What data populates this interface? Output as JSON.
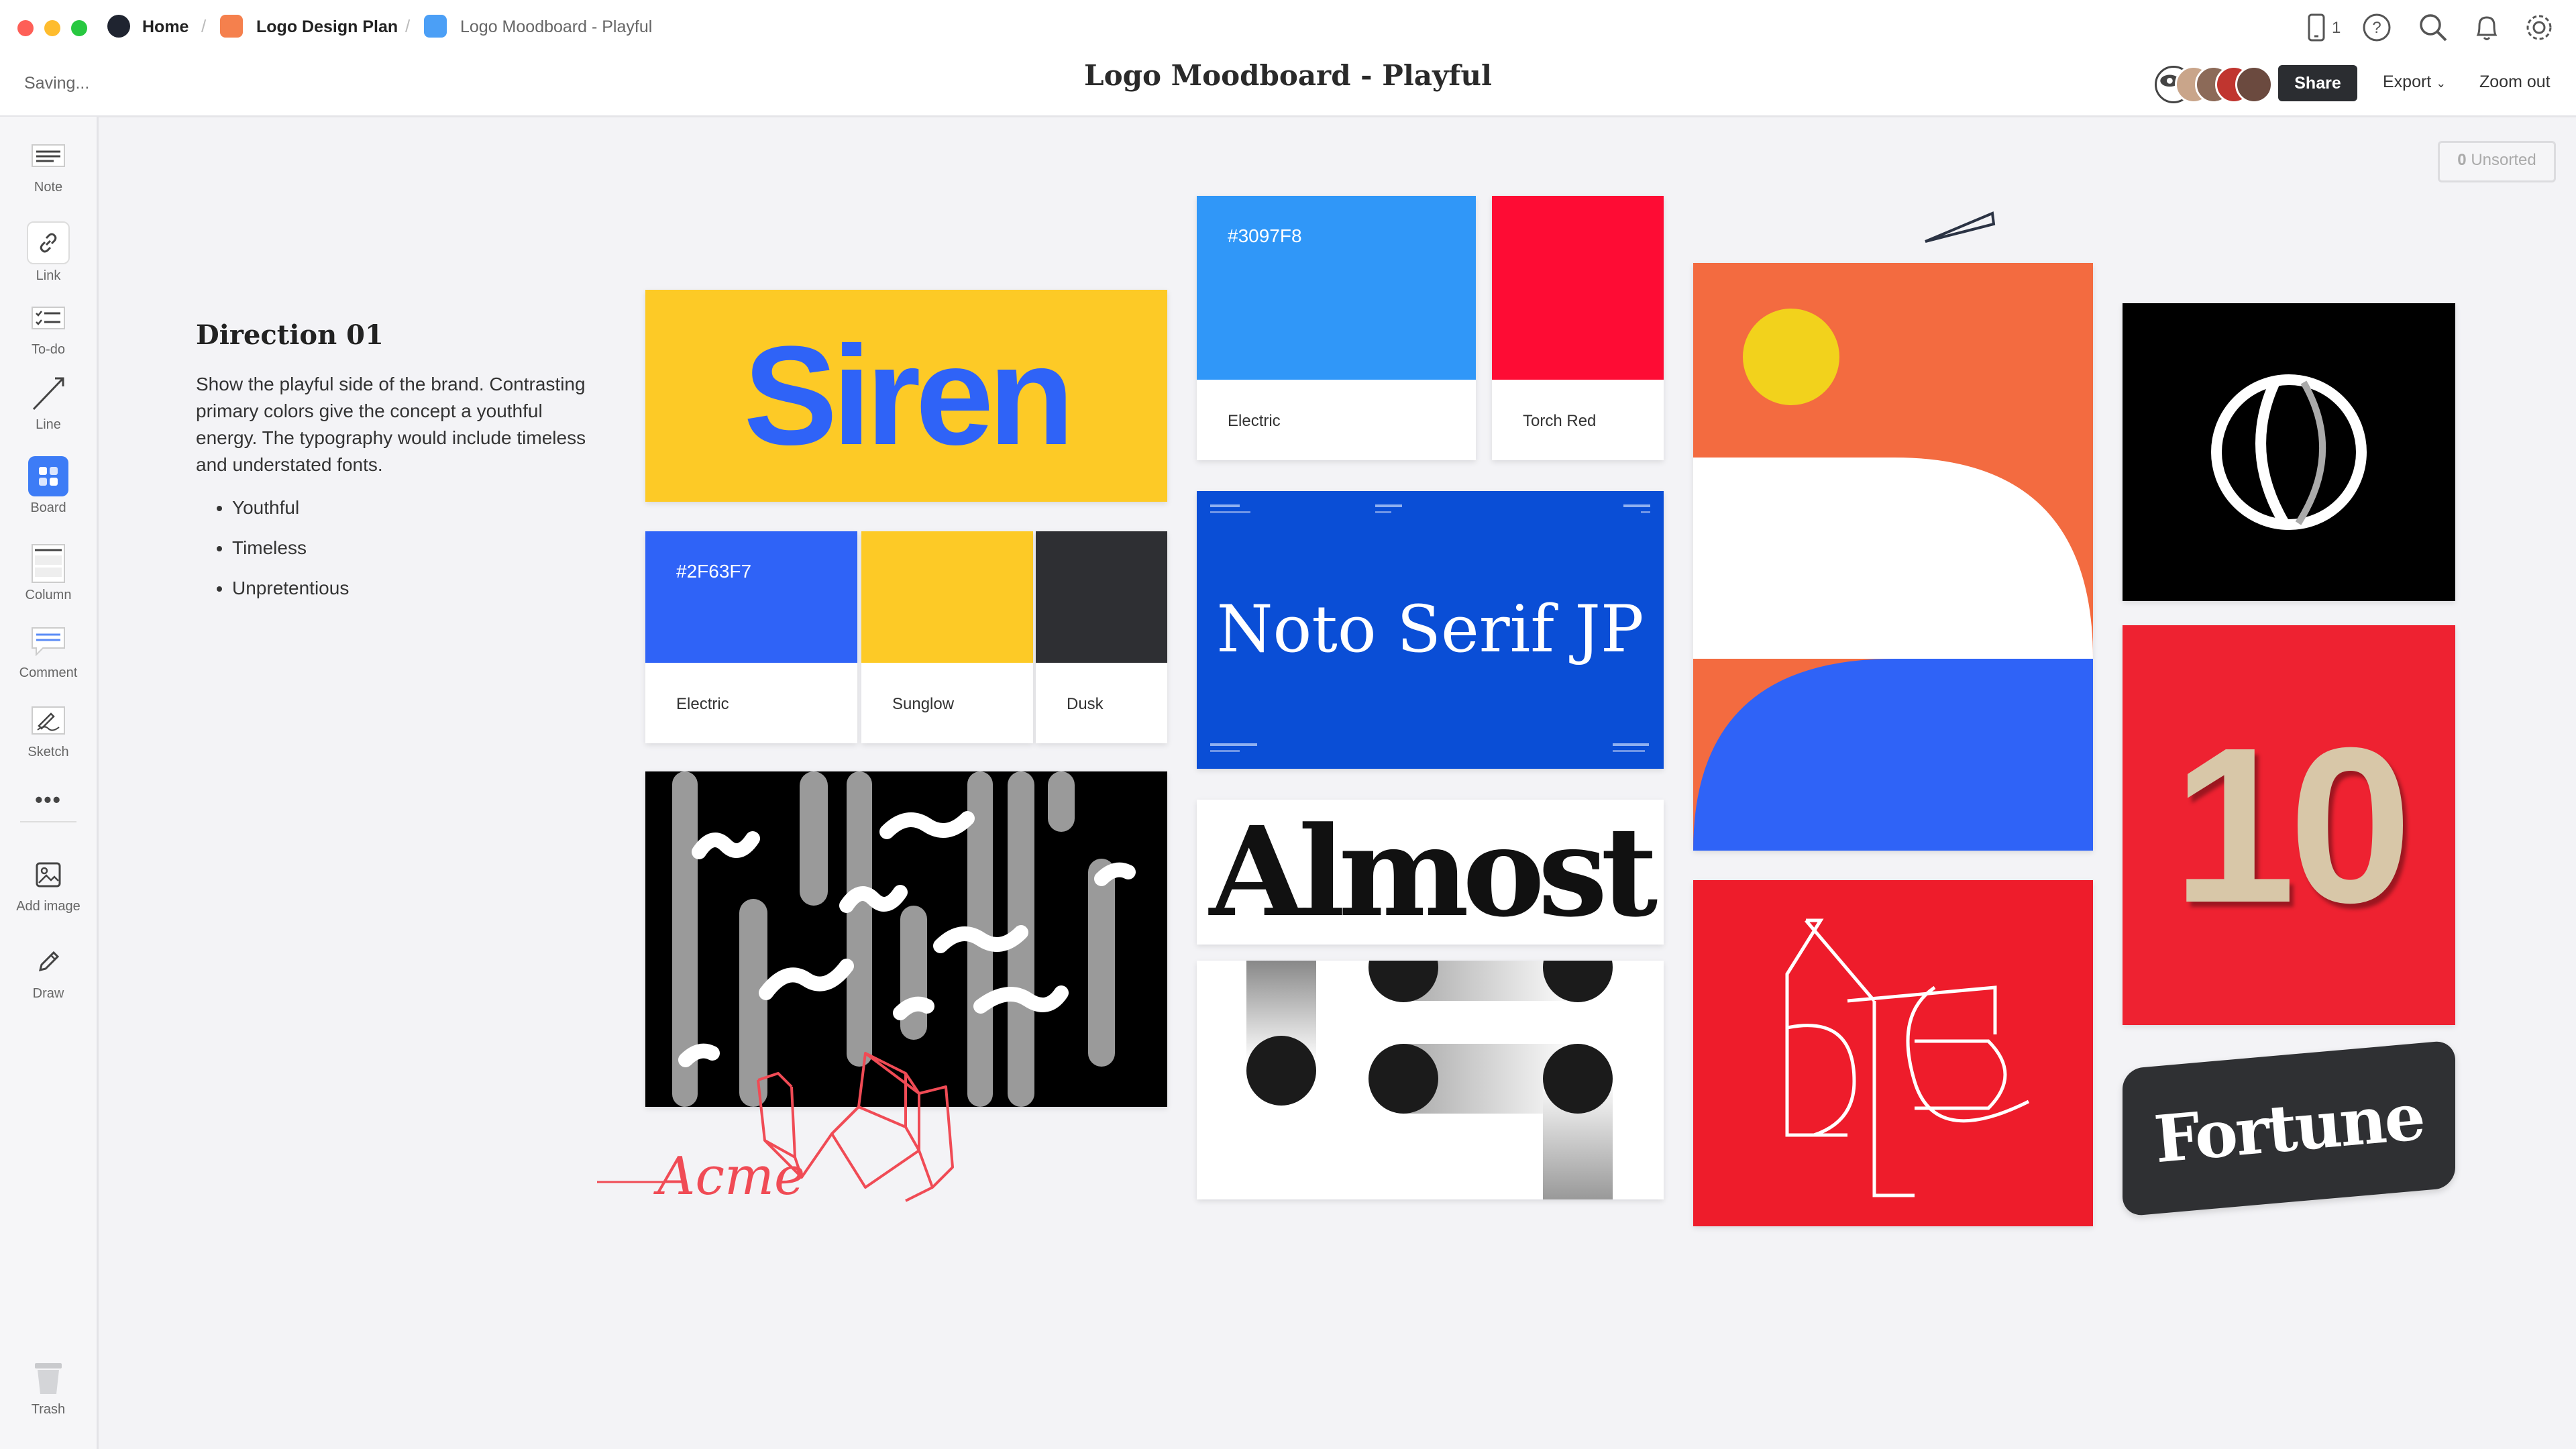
{
  "window": {
    "breadcrumbs": [
      "Home",
      "Logo Design Plan",
      "Logo Moodboard - Playful"
    ],
    "title": "Logo Moodboard - Playful",
    "status": "Saving...",
    "device_count": "1"
  },
  "toolbar": {
    "share_label": "Share",
    "export_label": "Export",
    "zoom_label": "Zoom out"
  },
  "sidebar": {
    "items": [
      {
        "label": "Note",
        "icon": "note-icon"
      },
      {
        "label": "Link",
        "icon": "link-icon"
      },
      {
        "label": "To-do",
        "icon": "todo-icon"
      },
      {
        "label": "Line",
        "icon": "line-icon"
      },
      {
        "label": "Board",
        "icon": "board-icon"
      },
      {
        "label": "Column",
        "icon": "column-icon"
      },
      {
        "label": "Comment",
        "icon": "comment-icon"
      },
      {
        "label": "Sketch",
        "icon": "sketch-icon"
      },
      {
        "label": "Add image",
        "icon": "image-icon"
      },
      {
        "label": "Draw",
        "icon": "pen-icon"
      }
    ],
    "trash_label": "Trash"
  },
  "canvas": {
    "unsorted_count": "0",
    "unsorted_label": "Unsorted",
    "note": {
      "title": "Direction 01",
      "body": "Show the playful side of the brand. Contrasting primary colors give the concept a youthful energy. The typography would include timeless and understated fonts.",
      "bullets": [
        "Youthful",
        "Timeless",
        "Unpretentious"
      ]
    },
    "siren_text": "Siren",
    "swatches_row1": [
      {
        "hex": "#2F63F7",
        "name": "Electric",
        "color": "#2f63f7",
        "show_hex": true
      },
      {
        "hex": "",
        "name": "Sunglow",
        "color": "#fdca26",
        "show_hex": false
      },
      {
        "hex": "",
        "name": "Dusk",
        "color": "#2e2f33",
        "show_hex": false
      }
    ],
    "swatches_row2": [
      {
        "hex": "#3097F8",
        "name": "Electric",
        "color": "#3097f8",
        "show_hex": true
      },
      {
        "hex": "",
        "name": "Torch Red",
        "color": "#fe0c34",
        "show_hex": false
      }
    ],
    "noto_text": "Noto Serif JP",
    "almost_text": "Almost",
    "fortune_text": "Fortune",
    "ten_text": "10",
    "sketch_text": "Acme"
  },
  "colors": {
    "accent": "#3d7cf6",
    "blue": "#0a4ed6",
    "red": "#ef1c2b",
    "orange": "#f36b40",
    "yellow": "#fdca26"
  }
}
